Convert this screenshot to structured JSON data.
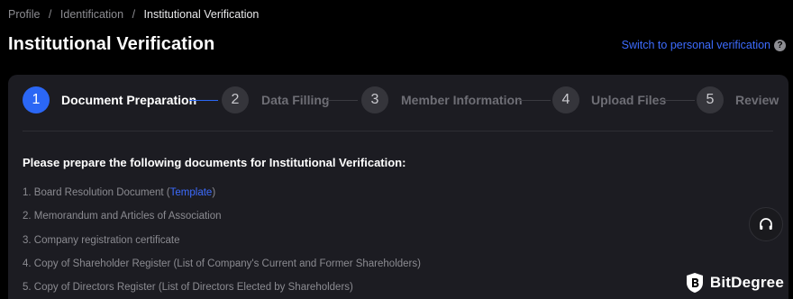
{
  "breadcrumb": {
    "items": [
      "Profile",
      "Identification",
      "Institutional Verification"
    ],
    "separator": "/"
  },
  "page": {
    "title": "Institutional Verification",
    "switch_link": "Switch to personal verification",
    "help_icon": "question-circle-icon"
  },
  "stepper": {
    "steps": [
      {
        "number": "1",
        "label": "Document Preparation",
        "state": "active"
      },
      {
        "number": "2",
        "label": "Data Filling",
        "state": "inactive"
      },
      {
        "number": "3",
        "label": "Member Information",
        "state": "inactive"
      },
      {
        "number": "4",
        "label": "Upload Files",
        "state": "inactive"
      },
      {
        "number": "5",
        "label": "Review",
        "state": "inactive"
      }
    ]
  },
  "content": {
    "intro": "Please prepare the following documents for Institutional Verification:",
    "documents": [
      {
        "prefix": "1. Board Resolution Document (",
        "link": "Template",
        "suffix": ")"
      },
      {
        "text": "2. Memorandum and Articles of Association"
      },
      {
        "text": "3. Company registration certificate"
      },
      {
        "text": "4. Copy of Shareholder Register (List of Company's Current and Former Shareholders)"
      },
      {
        "text": "5. Copy of Directors Register (List of Directors Elected by Shareholders)"
      }
    ]
  },
  "support": {
    "icon": "headset-icon"
  },
  "watermark": {
    "text": "BitDegree",
    "icon": "bitdegree-shield-icon"
  },
  "colors": {
    "background": "#000000",
    "card": "#1c1c22",
    "accent": "#2b67f5",
    "link": "#3d6cff",
    "muted_text": "#8b8b91"
  }
}
